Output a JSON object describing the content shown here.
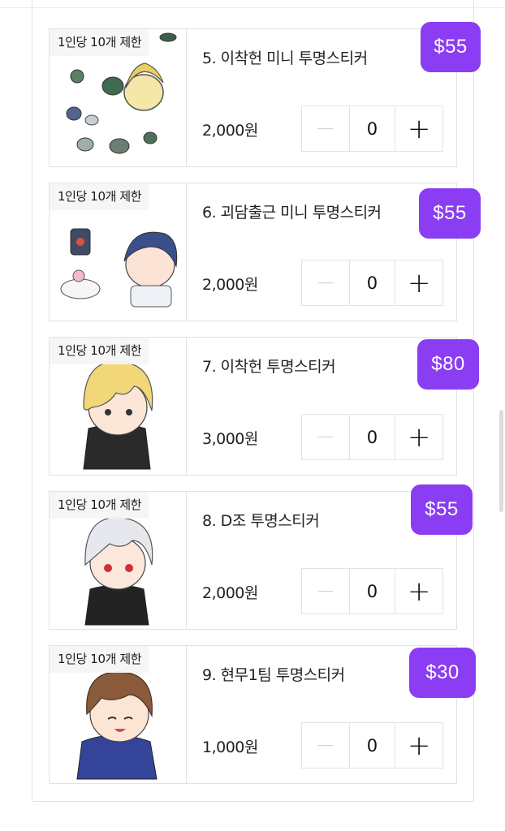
{
  "items": [
    {
      "title": "5. 이착헌 미니 투명스티커",
      "price": "2,000원",
      "limit": "1인당 10개 제한",
      "quantity": "0",
      "minus": "−",
      "plus": "+",
      "tag": "$55"
    },
    {
      "title": "6. 괴담출근 미니 투명스티커",
      "price": "2,000원",
      "limit": "1인당 10개 제한",
      "quantity": "0",
      "minus": "−",
      "plus": "+",
      "tag": "$55"
    },
    {
      "title": "7. 이착헌 투명스티커",
      "price": "3,000원",
      "limit": "1인당 10개 제한",
      "quantity": "0",
      "minus": "−",
      "plus": "+",
      "tag": "$80"
    },
    {
      "title": "8. D조 투명스티커",
      "price": "2,000원",
      "limit": "1인당 10개 제한",
      "quantity": "0",
      "minus": "−",
      "plus": "+",
      "tag": "$55"
    },
    {
      "title": "9. 현무1팀 투명스티커",
      "price": "1,000원",
      "limit": "1인당 10개 제한",
      "quantity": "0",
      "minus": "−",
      "plus": "+",
      "tag": "$30"
    }
  ],
  "colors": {
    "tag_background": "#8a3df2",
    "disabled_minus": "#d2d2d2",
    "border": "#e3e3e3"
  },
  "icons": {
    "minus": "minus-icon",
    "plus": "plus-icon"
  }
}
